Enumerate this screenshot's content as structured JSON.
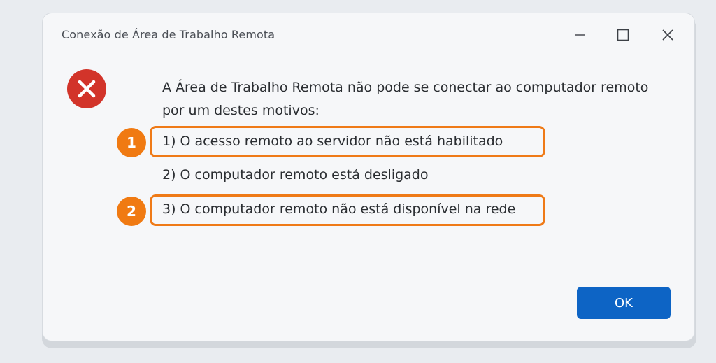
{
  "window": {
    "title": "Conexão de Área de Trabalho Remota"
  },
  "controls": {
    "minimize_icon": "minimize-icon",
    "maximize_icon": "maximize-icon",
    "close_icon": "close-icon"
  },
  "error": {
    "icon": "error-x-icon",
    "color": "#d2342a",
    "message_line1": "A Área de Trabalho Remota não pode se conectar ao computador remoto",
    "message_line2": "por um destes motivos:"
  },
  "reasons": [
    {
      "text": "1) O acesso remoto ao servidor não está habilitado",
      "highlighted": true,
      "marker": "1"
    },
    {
      "text": "2) O computador remoto está desligado",
      "highlighted": false
    },
    {
      "text": "3) O computador remoto não está disponível na rede",
      "highlighted": true,
      "marker": "2"
    }
  ],
  "annotation_color": "#ef7a17",
  "buttons": {
    "ok_label": "OK",
    "ok_color": "#0d64c5"
  }
}
